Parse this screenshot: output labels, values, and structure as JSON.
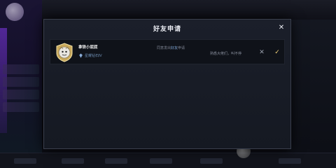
{
  "dialog": {
    "title": "好友申请",
    "close_glyph": "✕"
  },
  "requests": [
    {
      "player_name": "拿铁小屁屁",
      "rank_icon": "rank-icon",
      "rank_text": "星耀钻石Ⅳ",
      "message_prefix": "同意发出",
      "message_highlight": "好友",
      "message_suffix": "申请",
      "note": "熟悉大佬们，叫不停",
      "reject_glyph": "✕",
      "accept_glyph": "✓"
    }
  ],
  "colors": {
    "dialog_bg": "#1b1f2a",
    "row_bg": "#0f1219",
    "accept": "#f2d27a",
    "rank": "#6f8fb5",
    "highlight": "#7fa6d6"
  }
}
